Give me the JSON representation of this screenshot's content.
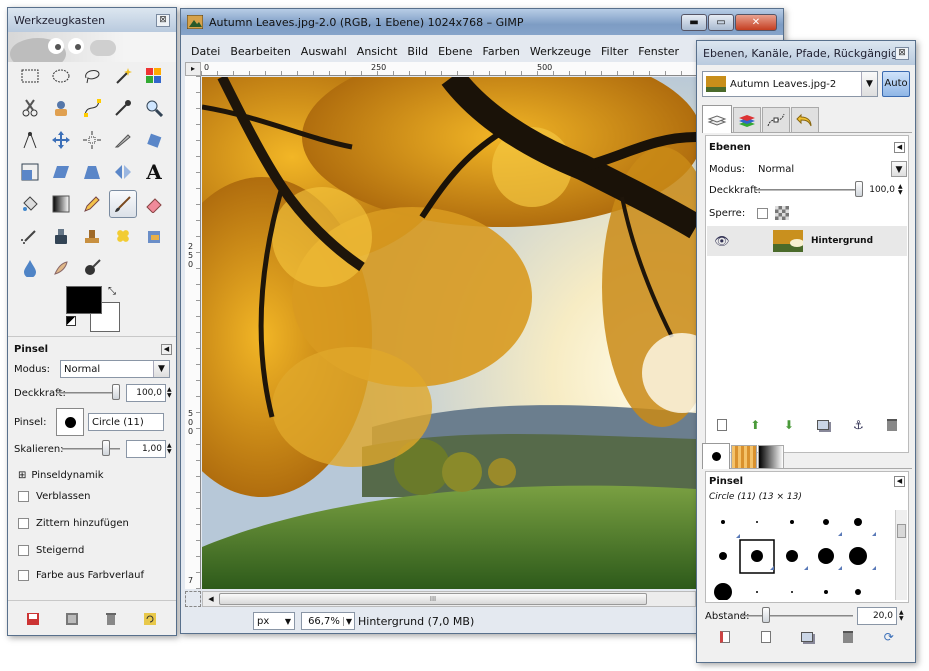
{
  "toolbox": {
    "title": "Werkzeugkasten",
    "close": "⊠",
    "tool_options": {
      "heading": "Pinsel",
      "mode_label": "Modus:",
      "mode_value": "Normal",
      "opacity_label": "Deckkraft:",
      "opacity_value": "100,0",
      "opacity_fraction": 1.0,
      "brush_label": "Pinsel:",
      "brush_value": "Circle (11)",
      "scale_label": "Skalieren:",
      "scale_value": "1,00",
      "scale_fraction": 0.8,
      "dynamics_label": "Pinseldynamik",
      "dynamics_expander": "⊞",
      "checkboxes": [
        "Verblassen",
        "Zittern hinzufügen",
        "Steigernd",
        "Farbe aus Farbverlauf"
      ]
    }
  },
  "image_window": {
    "title": "Autumn Leaves.jpg-2.0 (RGB, 1 Ebene) 1024x768 – GIMP",
    "menu": [
      "Datei",
      "Bearbeiten",
      "Auswahl",
      "Ansicht",
      "Bild",
      "Ebene",
      "Farben",
      "Werkzeuge",
      "Filter",
      "Fenster"
    ],
    "ruler_top": [
      "0",
      "250",
      "500"
    ],
    "ruler_left": [
      "2\n5\n0",
      "5\n0\n0",
      "7"
    ],
    "scroll_grip": "III",
    "unit": "px",
    "zoom": "66,7%",
    "status": "Hintergrund (7,0 MB)",
    "controls": {
      "minimize": "▬",
      "maximize": "▭",
      "close": "✕"
    }
  },
  "layers_dock": {
    "title": "Ebenen, Kanäle, Pfade, Rückgängig...",
    "image_select": "Autumn Leaves.jpg-2",
    "auto_button": "Auto",
    "layers_heading": "Ebenen",
    "mode_label": "Modus:",
    "mode_value": "Normal",
    "opacity_label": "Deckkraft:",
    "opacity_value": "100,0",
    "opacity_fraction": 1.0,
    "lock_label": "Sperre:",
    "layer_name": "Hintergrund",
    "brushes_heading": "Pinsel",
    "brush_info": "Circle (11) (13 × 13)",
    "spacing_label": "Abstand:",
    "spacing_value": "20,0",
    "spacing_fraction": 0.2
  },
  "colors": {
    "accent": "#7aa0d0",
    "foreground": "#000000",
    "background": "#ffffff"
  }
}
